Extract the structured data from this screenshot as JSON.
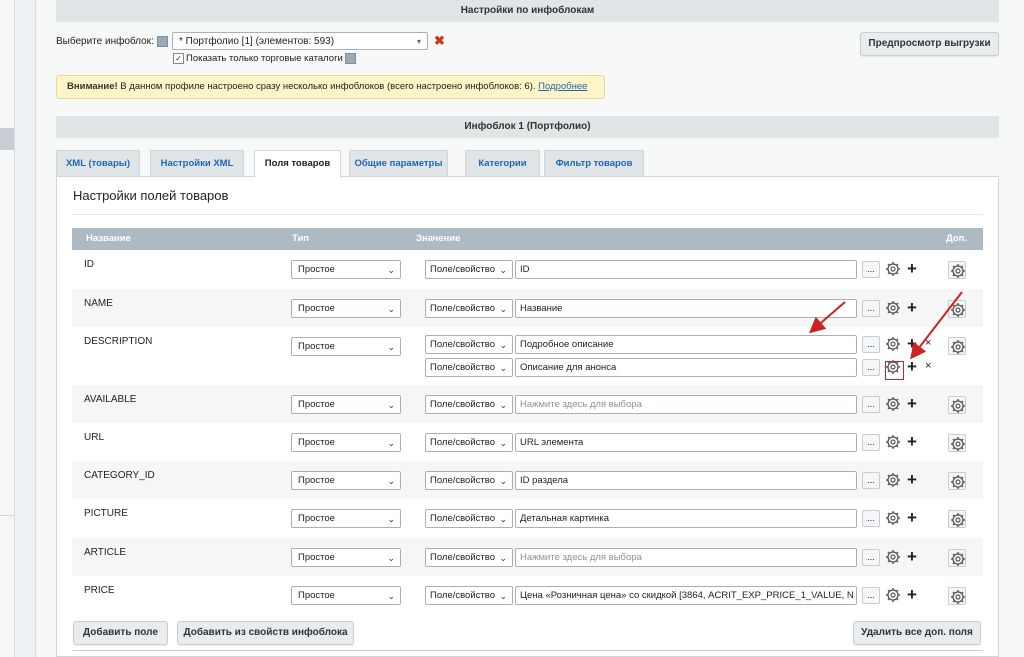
{
  "header": {
    "infoblock_settings_title": "Настройки по инфоблокам",
    "select_infoblock_label": "Выберите инфоблок:",
    "infoblock_value": "* Портфолио [1] (элементов: 593)",
    "show_catalogs_label": "Показать только торговые каталоги",
    "preview_button": "Предпросмотр выгрузки"
  },
  "warning": {
    "strong": "Внимание!",
    "text": " В данном профиле настроено сразу несколько инфоблоков (всего настроено инфоблоков: 6).",
    "link": "Подробнее"
  },
  "infoblock_title": "Инфоблок 1 (Портфолио)",
  "tabs": [
    {
      "label": "XML (товары)"
    },
    {
      "label": "Настройки XML"
    },
    {
      "label": "Поля товаров"
    },
    {
      "label": "Общие параметры"
    },
    {
      "label": "Категории"
    },
    {
      "label": "Фильтр товаров"
    }
  ],
  "panel_title": "Настройки полей товаров",
  "table": {
    "headers": {
      "name": "Название",
      "type": "Тип",
      "value": "Значение",
      "extra": "Доп."
    },
    "rows": [
      {
        "name": "ID",
        "type": "Простое",
        "source": "Поле/свойство",
        "value": "ID"
      },
      {
        "name": "NAME",
        "type": "Простое",
        "source": "Поле/свойство",
        "value": "Название"
      },
      {
        "name": "DESCRIPTION",
        "type": "Простое",
        "source": "Поле/свойство",
        "value": "Подробное описание",
        "source2": "Поле/свойство",
        "value2": "Описание для анонса"
      },
      {
        "name": "AVAILABLE",
        "type": "Простое",
        "source": "Поле/свойство",
        "value": "Нажмите здесь для выбора"
      },
      {
        "name": "URL",
        "type": "Простое",
        "source": "Поле/свойство",
        "value": "URL элемента"
      },
      {
        "name": "CATEGORY_ID",
        "type": "Простое",
        "source": "Поле/свойство",
        "value": "ID раздела"
      },
      {
        "name": "PICTURE",
        "type": "Простое",
        "source": "Поле/свойство",
        "value": "Детальная картинка"
      },
      {
        "name": "ARTICLE",
        "type": "Простое",
        "source": "Поле/свойство",
        "value": "Нажмите здесь для выбора"
      },
      {
        "name": "PRICE",
        "type": "Простое",
        "source": "Поле/свойство",
        "value": "Цена «Розничная цена» со скидкой [3864, ACRIT_EXP_PRICE_1_VALUE, N"
      }
    ]
  },
  "buttons": {
    "add_field": "Добавить поле",
    "add_from_props": "Добавить из свойств инфоблока",
    "delete_extra": "Удалить все доп. поля"
  },
  "icons": {
    "dots": "...",
    "plus": "+",
    "remove": "×",
    "dropdown": "▾",
    "clear": "✖"
  }
}
